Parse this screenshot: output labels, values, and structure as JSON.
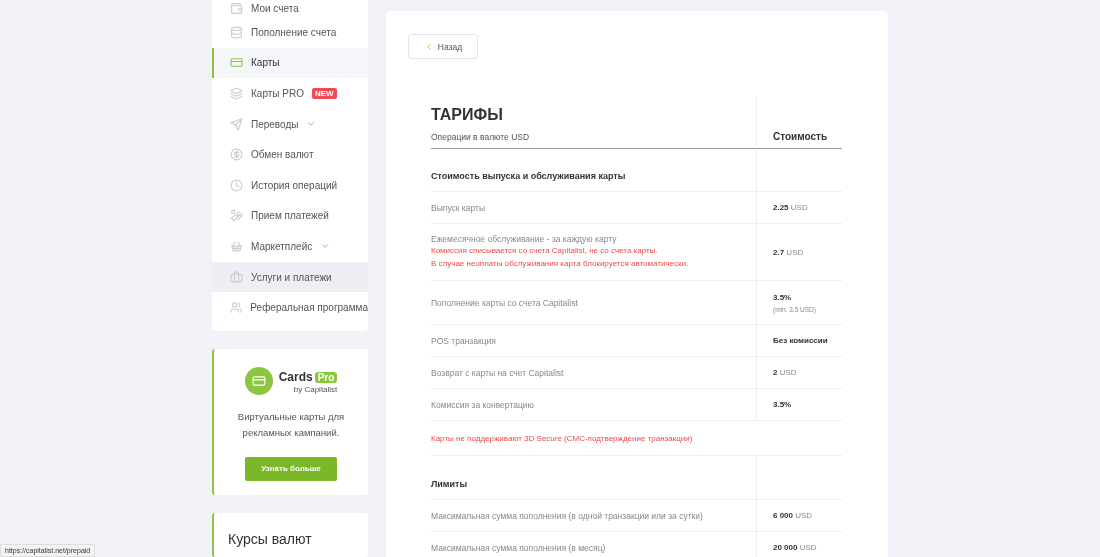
{
  "sidebar": {
    "items": [
      {
        "label": "Мои счета",
        "selected": false,
        "highlighted": false,
        "expandable": false
      },
      {
        "label": "Пополнение счета",
        "selected": false,
        "highlighted": false,
        "expandable": false
      },
      {
        "label": "Карты",
        "selected": true,
        "highlighted": false,
        "expandable": false
      },
      {
        "label": "Карты PRO",
        "selected": false,
        "highlighted": false,
        "expandable": false,
        "badge": "NEW"
      },
      {
        "label": "Переводы",
        "selected": false,
        "highlighted": false,
        "expandable": true
      },
      {
        "label": "Обмен валют",
        "selected": false,
        "highlighted": false,
        "expandable": false
      },
      {
        "label": "История операций",
        "selected": false,
        "highlighted": false,
        "expandable": false
      },
      {
        "label": "Прием платежей",
        "selected": false,
        "highlighted": false,
        "expandable": false
      },
      {
        "label": "Маркетплейс",
        "selected": false,
        "highlighted": false,
        "expandable": true
      },
      {
        "label": "Услуги и платежи",
        "selected": false,
        "highlighted": true,
        "expandable": false
      },
      {
        "label": "Реферальная программа",
        "selected": false,
        "highlighted": false,
        "expandable": false
      }
    ]
  },
  "promo": {
    "brand": "Cards",
    "brand_tag": "Pro",
    "brand_by": "by Capitalist",
    "text": "Виртуальные карты для рекламных кампаний.",
    "button": "Узнать больше"
  },
  "rates_card": {
    "title": "Курсы валют"
  },
  "back_button": "Назад",
  "tariffs": {
    "title": "ТАРИФЫ",
    "subtitle": "Операции в валюте USD",
    "value_header": "Стоимость",
    "rows": [
      {
        "kind": "section",
        "label": "Стоимость выпуска и обслуживания карты"
      },
      {
        "kind": "row",
        "label": "Выпуск карты",
        "value": "**2.25** USD"
      },
      {
        "kind": "row",
        "label": "Ежемесячное обслуживание - за каждую карту",
        "notes": [
          "Комиссия списывается со счета Capitalist, не со счета карты.",
          "В случае неоплаты обслуживания карта блокируется автоматически."
        ],
        "value": "**2.7** USD"
      },
      {
        "kind": "row",
        "label": "Пополнение карты со счета Capitalist",
        "value": "**3.5%**",
        "value_note": "(min. 3.5 USD)"
      },
      {
        "kind": "row",
        "label": "POS транзакция",
        "value": "**Без комиссии**"
      },
      {
        "kind": "row",
        "label": "Возврат с карты на счет Capitalist",
        "value": "**2** USD"
      },
      {
        "kind": "row",
        "label": "Комиссия за конвертацию",
        "value": "**3.5%**"
      },
      {
        "kind": "note",
        "label": "Карты не поддерживают 3D Secure (СМС-подтверждение транзакции)"
      },
      {
        "kind": "section",
        "label": "Лимиты"
      },
      {
        "kind": "row",
        "label": "Максимальная сумма пополнения (в одной транзакции или за сутки)",
        "value": "**6 000** USD"
      },
      {
        "kind": "row",
        "label": "Максимальная сумма пополнения (в месяц)",
        "value": "**20 000** USD"
      }
    ]
  },
  "status_bar": {
    "url": "https://capitalist.net/prepaid"
  }
}
